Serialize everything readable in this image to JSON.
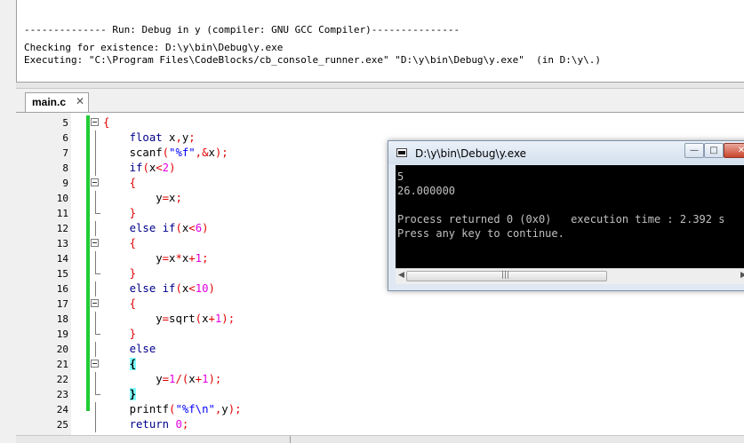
{
  "build_log": {
    "lines": [
      "-------------- Run: Debug in y (compiler: GNU GCC Compiler)---------------",
      "Checking for existence: D:\\y\\bin\\Debug\\y.exe",
      "Executing: \"C:\\Program Files\\CodeBlocks/cb_console_runner.exe\" \"D:\\y\\bin\\Debug\\y.exe\"  (in D:\\y\\.)"
    ]
  },
  "editor": {
    "tab_label": "main.c",
    "tab_close": "✕",
    "line_numbers": [
      "5",
      "6",
      "7",
      "8",
      "9",
      "10",
      "11",
      "12",
      "13",
      "14",
      "15",
      "16",
      "17",
      "18",
      "19",
      "20",
      "21",
      "22",
      "23",
      "24",
      "25"
    ]
  },
  "console": {
    "title": "D:\\y\\bin\\Debug\\y.exe",
    "min_label": "—",
    "max_label": "□",
    "close_label": "✕",
    "lines": [
      "5",
      "26.000000",
      "",
      "Process returned 0 (0x0)   execution time : 2.392 s",
      "Press any key to continue."
    ],
    "scroll_left": "◀",
    "scroll_grip": "|||",
    "scroll_right": "▶"
  },
  "colors": {
    "keyword": "#00008b",
    "string": "#0000ff",
    "operator": "#e00000",
    "number": "#e000e0",
    "brace_highlight": "#80ffff",
    "change_bar": "#22cc33"
  }
}
